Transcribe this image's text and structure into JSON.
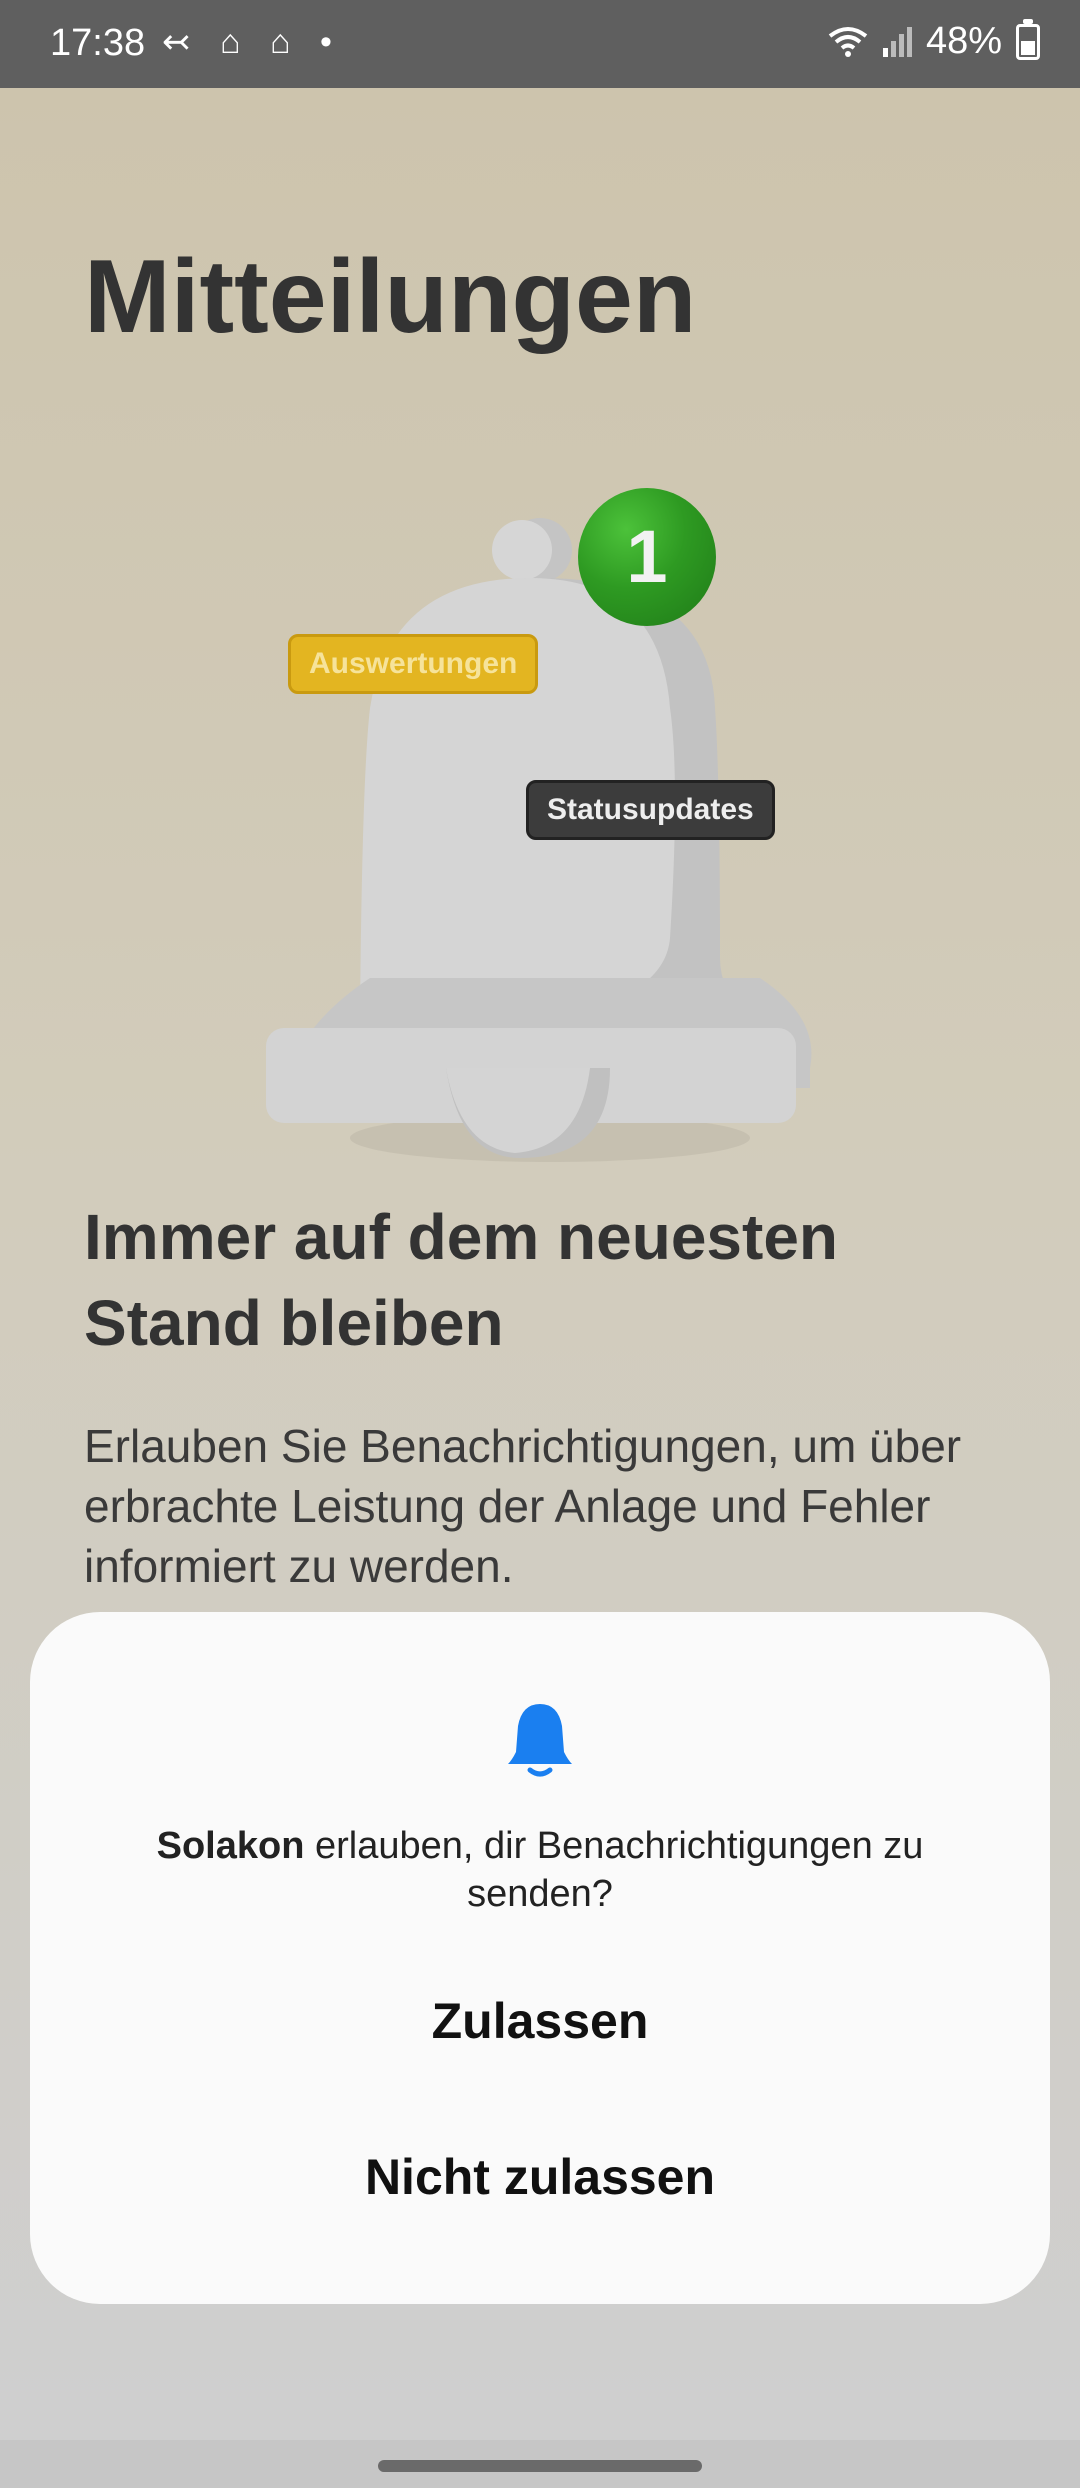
{
  "status_bar": {
    "time": "17:38",
    "left_icons": [
      "call-forward-icon",
      "app-notification-icon",
      "app-notification-icon",
      "dot-icon"
    ],
    "battery_percent": "48%",
    "right_icons": [
      "wifi-icon",
      "signal-icon",
      "battery-icon"
    ]
  },
  "screen": {
    "title": "Mitteilungen",
    "illustration": {
      "badge_count": "1",
      "tag_yellow": "Auswertungen",
      "tag_dark": "Statusupdates"
    },
    "headline": "Immer auf dem neuesten Stand bleiben",
    "description": "Erlauben Sie Benachrichtigungen, um über erbrachte Leistung der Anlage und Fehler informiert zu werden."
  },
  "dialog": {
    "app_name": "Solakon",
    "message": " erlauben, dir Benachrichtigungen zu senden?",
    "allow_label": "Zulassen",
    "deny_label": "Nicht zulassen"
  },
  "colors": {
    "dialog_accent": "#1a7ff0",
    "badge_green": "#2e9a22",
    "tag_yellow": "#e3b521",
    "tag_dark": "#3c3c3c"
  }
}
